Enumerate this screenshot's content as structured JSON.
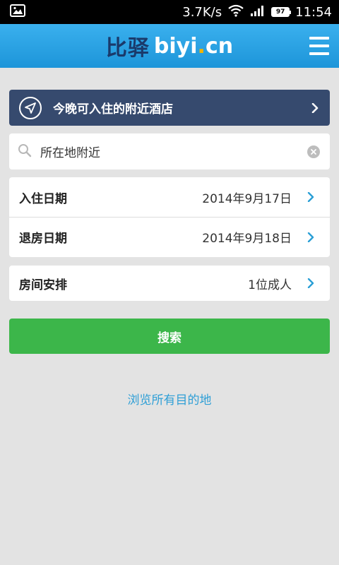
{
  "status_bar": {
    "speed": "3.7K/s",
    "battery": "97",
    "time": "11:54",
    "icons": [
      "image-notification-icon",
      "wifi-icon",
      "signal-icon",
      "battery-icon"
    ]
  },
  "header": {
    "logo_cn": "比驿",
    "logo_en_a": "biyi",
    "logo_en_dot": ".",
    "logo_en_b": "cn",
    "menu_icon": "hamburger-menu-icon"
  },
  "nearby": {
    "label": "今晚可入住的附近酒店",
    "icon": "navigation-arrow-icon"
  },
  "search": {
    "value": "所在地附近",
    "placeholder": ""
  },
  "dates": {
    "checkin_label": "入住日期",
    "checkin_value": "2014年9月17日",
    "checkout_label": "退房日期",
    "checkout_value": "2014年9月18日"
  },
  "room": {
    "label": "房间安排",
    "value": "1位成人"
  },
  "search_button": {
    "label": "搜索"
  },
  "browse_link": {
    "label": "浏览所有目的地"
  },
  "colors": {
    "header": "#1d95d9",
    "banner": "#364a6e",
    "search_button": "#3cb64a",
    "link": "#2f9fd6",
    "chevron": "#2a9fd6"
  }
}
